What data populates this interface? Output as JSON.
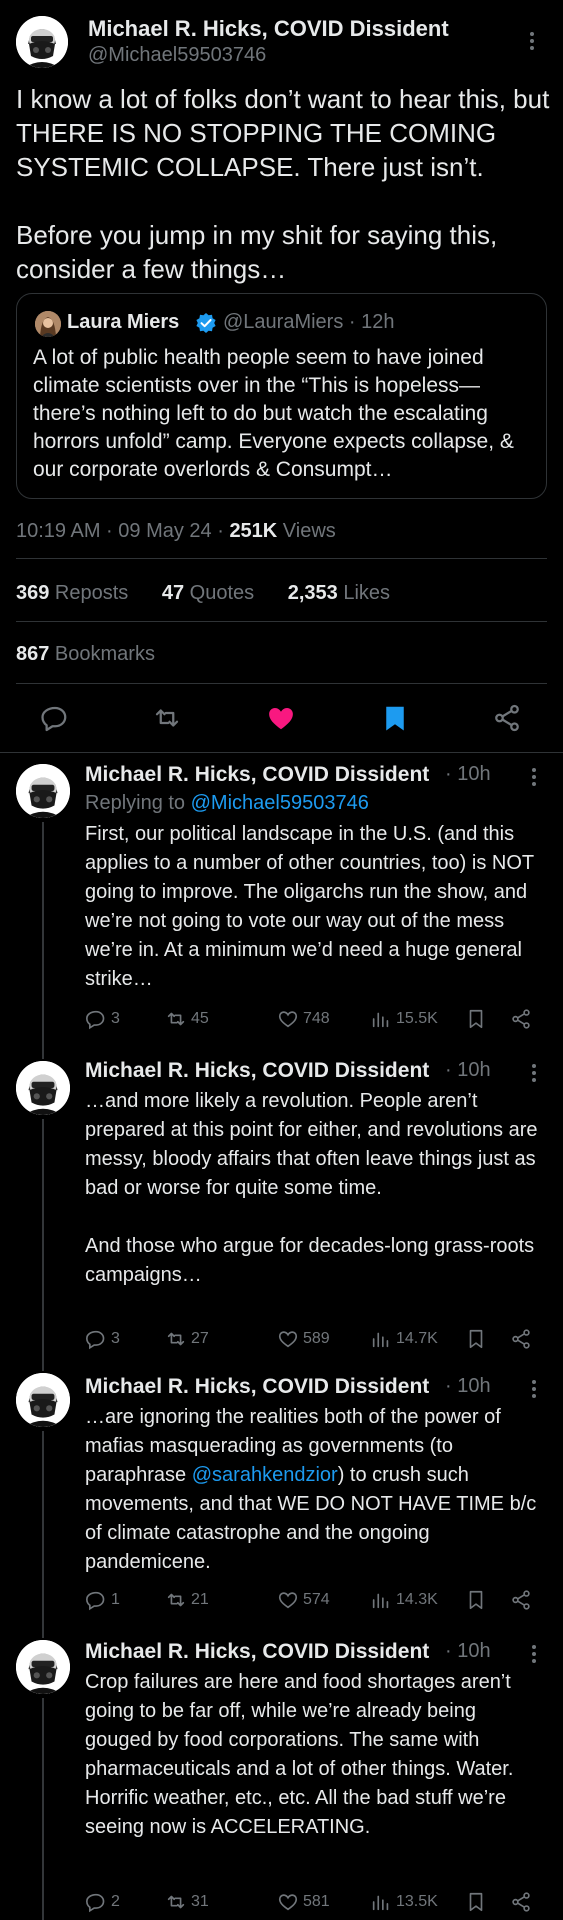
{
  "main_post": {
    "author_name": "Michael R. Hicks, COVID Dissident",
    "author_handle": "@Michael59503746",
    "text": "I know a lot of folks don’t want to hear this, but THERE IS NO STOPPING THE COMING SYSTEMIC COLLAPSE. There just isn’t.\n\nBefore you jump in my shit for saying this, consider a few things…",
    "quoted": {
      "author_name": "Laura Miers",
      "author_handle": "@LauraMiers · 12h",
      "text": "A lot of public health people seem to have joined climate scientists over in the “This is hopeless—there’s nothing left to do but watch the escalating horrors unfold” camp. Everyone expects collapse, & our corporate overlords & Consumpt…"
    },
    "timestamp": "10:19 AM · 09 May 24 · ",
    "views_count": "251K",
    "views_label": " Views",
    "reposts_count": "369",
    "reposts_label": " Reposts",
    "quotes_count": "47",
    "quotes_label": " Quotes",
    "likes_count": "2,353",
    "likes_label": " Likes",
    "bookmarks_count": "867",
    "bookmarks_label": " Bookmarks",
    "liked": true,
    "bookmarked": true
  },
  "colors": {
    "background": "#000000",
    "text": "#e7e9ea",
    "muted": "#71767b",
    "link": "#1d9bf0",
    "like": "#f91880",
    "divider": "#2f3336"
  },
  "replies": [
    {
      "author_name": "Michael R. Hicks, COVID Dissident",
      "time": "· 10h",
      "replying_label": "Replying to ",
      "replying_handle": "@Michael59503746",
      "text": "First, our political landscape in the U.S. (and this applies to a number of other countries, too) is NOT going to improve. The oligarchs run the show, and we’re not going to vote our way out of the mess we’re in. At a minimum we’d need a huge general strike…",
      "replies": "3",
      "reposts": "45",
      "likes": "748",
      "views": "15.5K"
    },
    {
      "author_name": "Michael R. Hicks, COVID Dissident",
      "time": "· 10h",
      "text": "…and more likely a revolution. People aren’t prepared at this point for either, and revolutions are messy, bloody affairs that often leave things just as bad or worse for quite some time.\n\nAnd those who argue for decades-long grass-roots campaigns…",
      "replies": "3",
      "reposts": "27",
      "likes": "589",
      "views": "14.7K"
    },
    {
      "author_name": "Michael R. Hicks, COVID Dissident",
      "time": "· 10h",
      "text_before": "…are ignoring the realities both of the power of mafias masquerading as governments (to paraphrase ",
      "text_mention": "@sarahkendzior",
      "text_after": ") to crush such movements, and that WE DO NOT HAVE TIME b/c of climate catastrophe and the ongoing pandemicene.",
      "replies": "1",
      "reposts": "21",
      "likes": "574",
      "views": "14.3K"
    },
    {
      "author_name": "Michael R. Hicks, COVID Dissident",
      "time": "· 10h",
      "text": "Crop failures are here and food shortages aren’t going to be far off, while we’re already being gouged by food corporations. The same with pharmaceuticals and a lot of other things. Water. Horrific weather, etc., etc. All the bad stuff we’re seeing now is ACCELERATING.",
      "replies": "2",
      "reposts": "31",
      "likes": "581",
      "views": "13.5K"
    }
  ]
}
